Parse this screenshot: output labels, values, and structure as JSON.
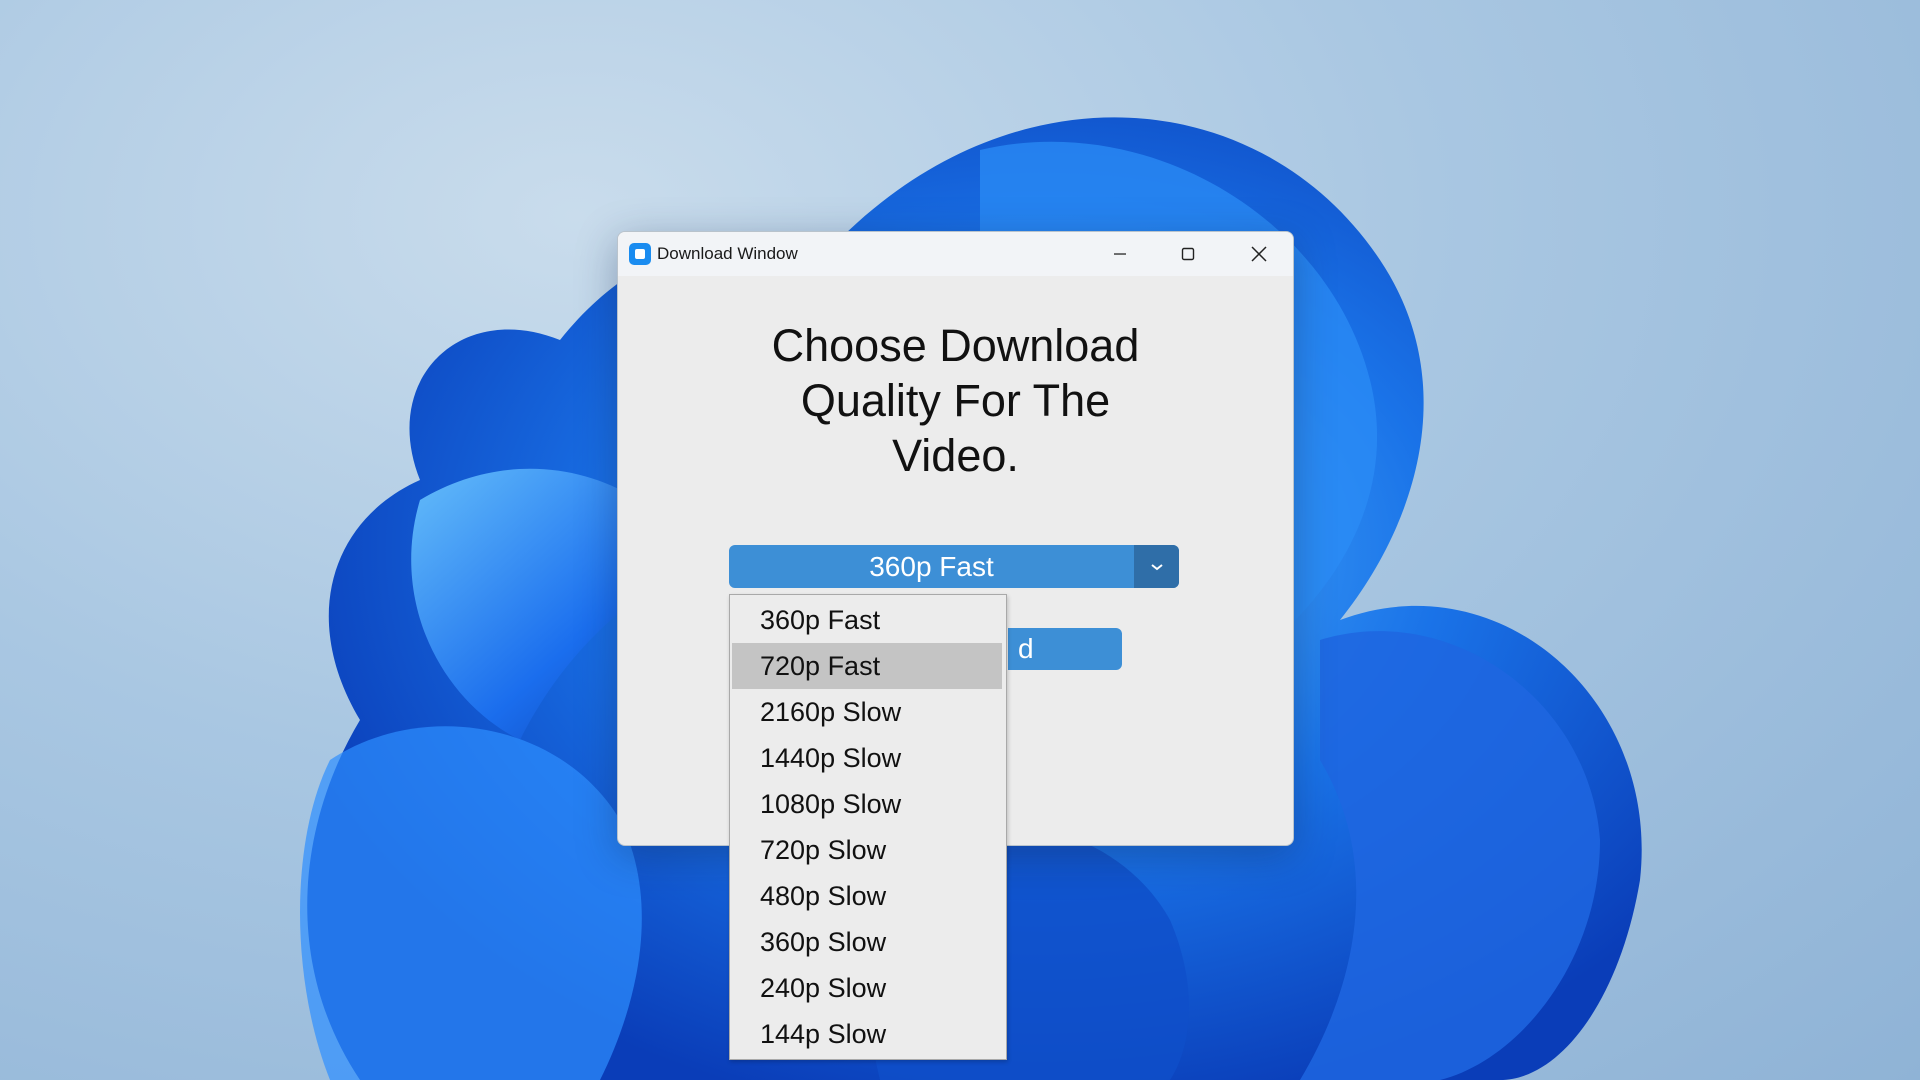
{
  "window": {
    "title": "Download Window"
  },
  "heading": {
    "line1": "Choose Download",
    "line2": "Quality For The",
    "line3": "Video."
  },
  "quality_select": {
    "selected": "360p Fast",
    "highlighted": "720p Fast",
    "options": [
      "360p Fast",
      "720p Fast",
      "2160p Slow",
      "1440p Slow",
      "1080p Slow",
      "720p Slow",
      "480p Slow",
      "360p Slow",
      "240p Slow",
      "144p Slow"
    ]
  },
  "download_button": {
    "visible_label": "d"
  },
  "icons": {
    "app": "app-icon",
    "minimize": "minimize-icon",
    "maximize": "maximize-icon",
    "close": "close-icon",
    "dropdown": "chevron-down-icon"
  },
  "colors": {
    "accent": "#3d8fd6",
    "accent_dark": "#2f6ea8",
    "highlight": "#c4c4c4"
  }
}
